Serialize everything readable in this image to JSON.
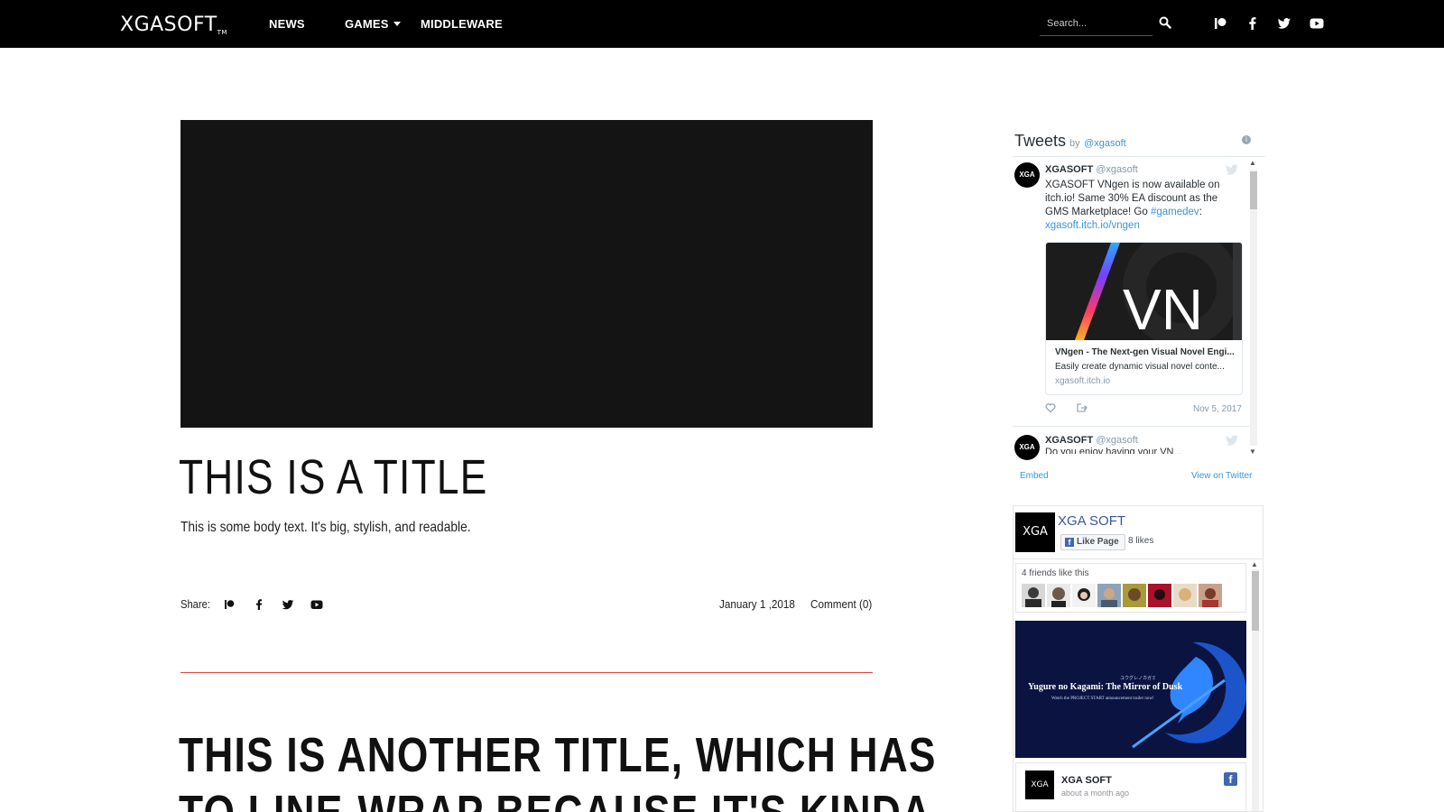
{
  "nav": {
    "logo": "XGASOFT",
    "logo_tm": "TM",
    "items": [
      "NEWS",
      "GAMES",
      "MIDDLEWARE"
    ],
    "search_placeholder": "Search...",
    "social_icons": [
      "patreon-icon",
      "facebook-icon",
      "twitter-icon",
      "youtube-icon"
    ]
  },
  "posts": [
    {
      "title": "THIS IS A TITLE",
      "body": "This is some body text. It's big, stylish, and readable.",
      "share_label": "Share:",
      "date": "January 1 ,2018",
      "comments": "Comment (0)"
    },
    {
      "title": "THIS IS ANOTHER TITLE, WHICH HAS",
      "title_line2": "TO LINE-WRAP BECAUSE IT'S KINDA"
    }
  ],
  "twitter": {
    "heading": "Tweets",
    "by": "by",
    "handle": "@xgasoft",
    "tweet1": {
      "avatar": "XGA",
      "name": "XGASOFT",
      "handle": "@xgasoft",
      "text_before": "XGASOFT VNgen is now available on itch.io! Same 30% EA discount as the GMS Marketplace! Go ",
      "hashtag": "#gamedev",
      "colon": ":",
      "link": "xgasoft.itch.io/vngen",
      "card_image_text": "VN",
      "card_title": "VNgen - The Next-gen Visual Novel Engi...",
      "card_desc": "Easily create dynamic visual novel conte...",
      "card_url": "xgasoft.itch.io",
      "date": "Nov 5, 2017"
    },
    "tweet2": {
      "avatar": "XGA",
      "name": "XGASOFT",
      "handle": "@xgasoft",
      "text_fragment": "Do you enjoy having your VN..."
    },
    "embed": "Embed",
    "view": "View on Twitter"
  },
  "facebook": {
    "logo": "XGA",
    "page_name": "XGA SOFT",
    "like_button": "Like Page",
    "likes": "8 likes",
    "friends_label": "4 friends like this",
    "post_image_caption": "Yugure no Kagami: The Mirror of Dusk",
    "post_image_subcaption": "Watch the PROJECT START announcement trailer now!",
    "post_image_jp": "ユウグレノカガミ",
    "post_logo": "XGA",
    "post_name": "XGA SOFT",
    "post_time": "about a month ago"
  },
  "colors": {
    "nav_bg": "#000000",
    "divider": "#d8483a",
    "twitter_link": "#3b94d9",
    "facebook_blue": "#4267b2"
  }
}
